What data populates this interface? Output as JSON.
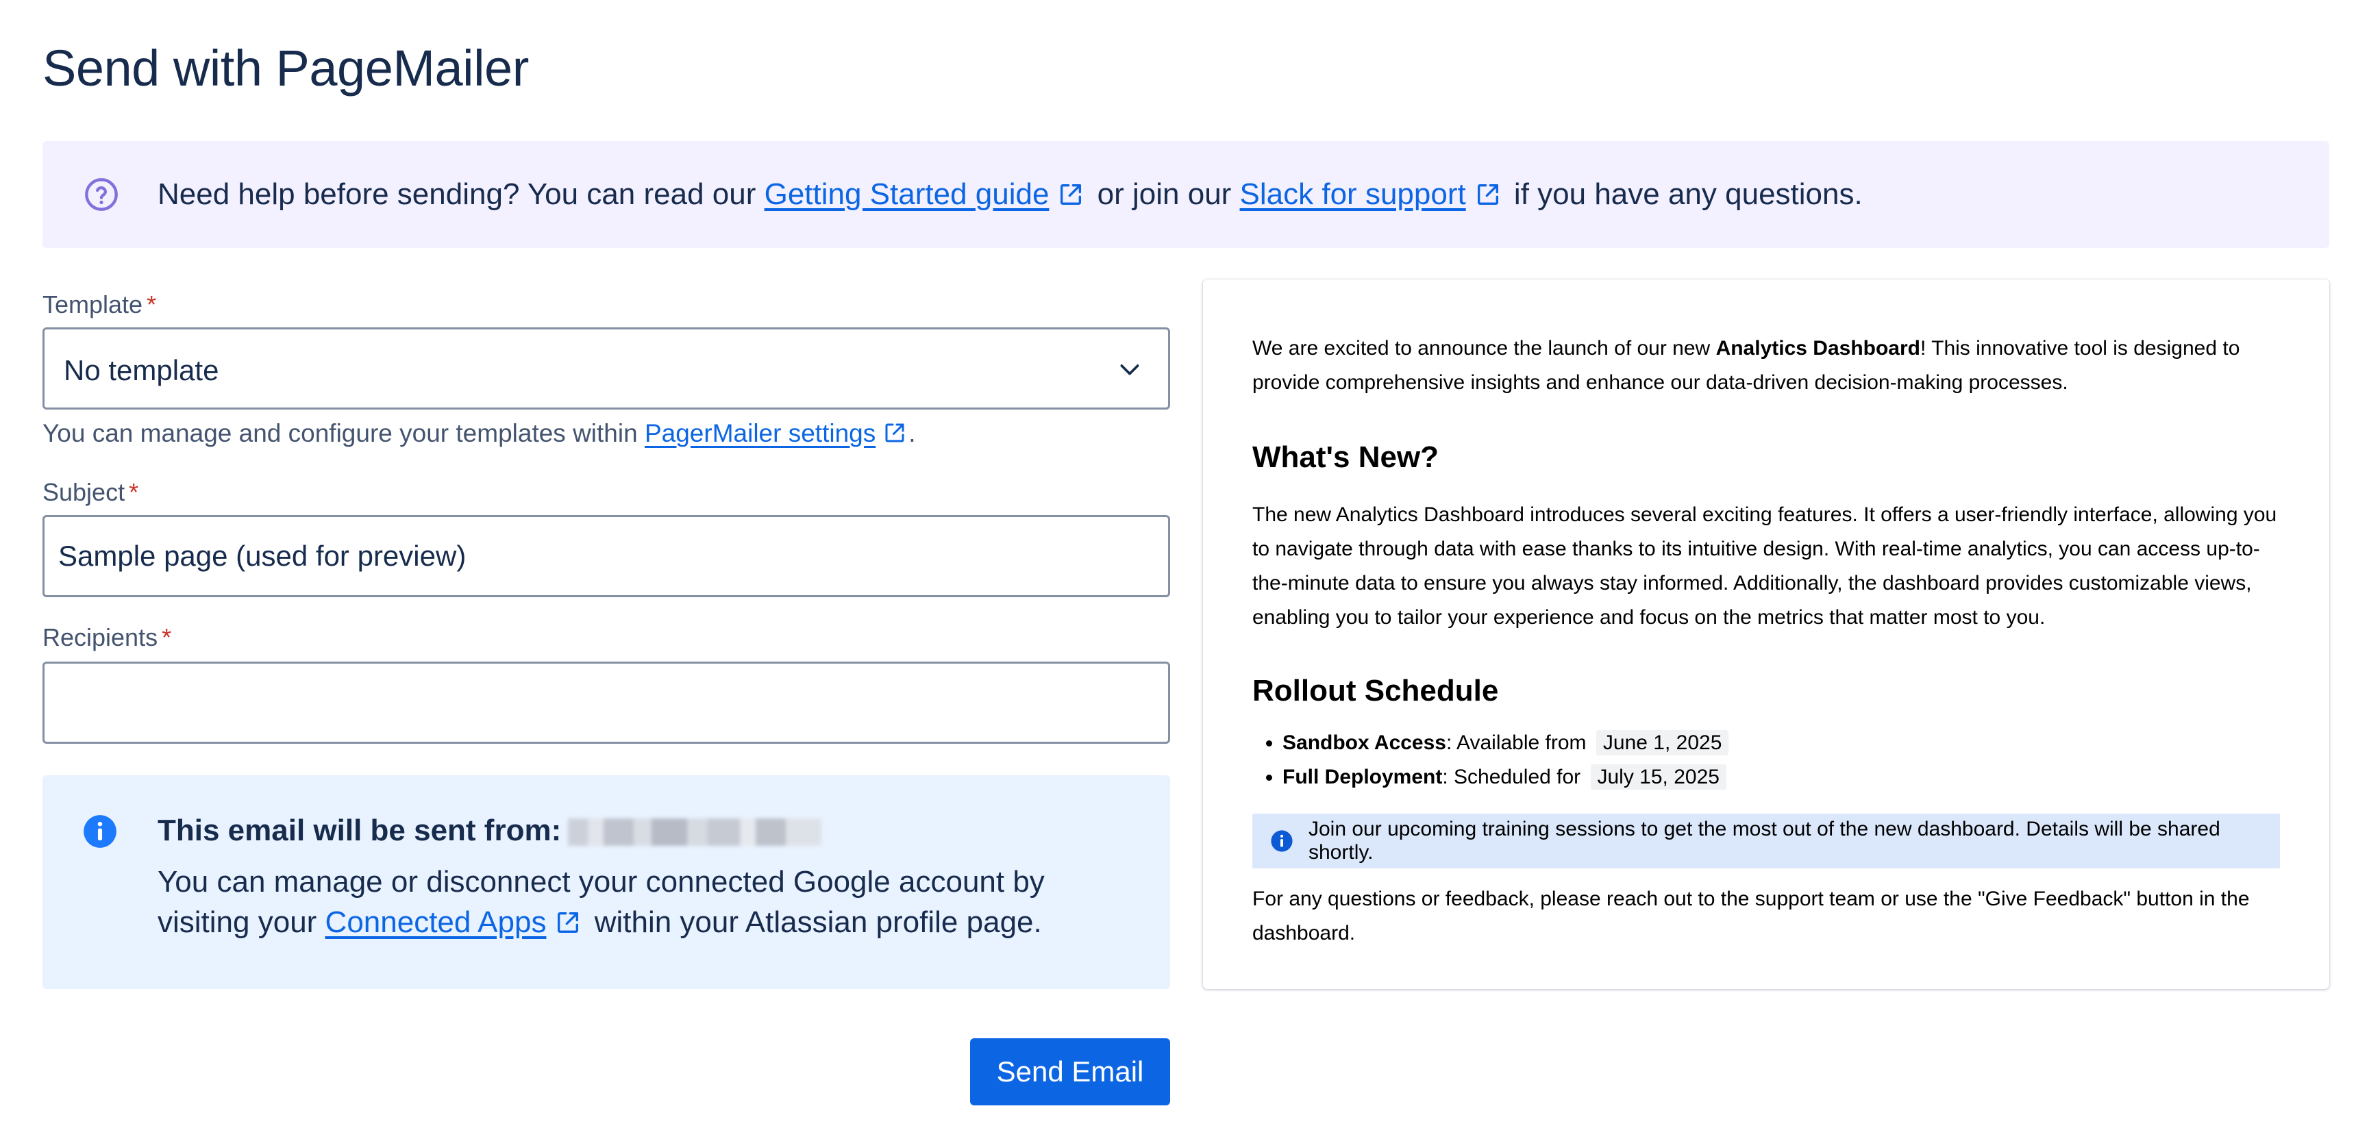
{
  "page": {
    "title": "Send with PageMailer"
  },
  "help_banner": {
    "text_before": "Need help before sending? You can read our ",
    "link1_label": "Getting Started guide",
    "text_middle": " or join our ",
    "link2_label": "Slack for support",
    "text_after": " if you have any questions.",
    "icon": "question-circle-icon"
  },
  "form": {
    "template": {
      "label": "Template",
      "required_mark": "*",
      "value": "No template",
      "helper_before": "You can manage and configure your templates within ",
      "helper_link": "PagerMailer settings",
      "helper_after": "."
    },
    "subject": {
      "label": "Subject",
      "required_mark": "*",
      "value": "Sample page (used for preview)"
    },
    "recipients": {
      "label": "Recipients",
      "required_mark": "*",
      "value": ""
    },
    "send_label": "Send Email"
  },
  "sender_info": {
    "title": "This email will be sent from:",
    "body_before": "You can manage or disconnect your connected Google account by visiting your ",
    "link_label": "Connected Apps",
    "body_after": " within your Atlassian profile page.",
    "icon": "info-circle-icon"
  },
  "preview": {
    "intro_before": "We are excited to announce the launch of our new ",
    "intro_bold": "Analytics Dashboard",
    "intro_after": "! This innovative tool is designed to provide comprehensive insights and enhance our data-driven decision-making processes.",
    "heading1": "What's New?",
    "paragraph1": "The new Analytics Dashboard introduces several exciting features. It offers a user-friendly interface, allowing you to navigate through data with ease thanks to its intuitive design. With real-time analytics, you can access up-to-the-minute data to ensure you always stay informed. Additionally, the dashboard provides customizable views, enabling you to tailor your experience and focus on the metrics that matter most to you.",
    "heading2": "Rollout Schedule",
    "schedule": [
      {
        "label": "Sandbox Access",
        "text": ": Available from ",
        "date": "June 1, 2025"
      },
      {
        "label": "Full Deployment",
        "text": ": Scheduled for ",
        "date": "July 15, 2025"
      }
    ],
    "info_note": "Join our upcoming training sessions to get the most out of the new dashboard. Details will be shared shortly.",
    "closing": "For any questions or feedback, please reach out to the support team or use the \"Give Feedback\" button in the dashboard."
  },
  "colors": {
    "brand_blue": "#0c66e4",
    "help_bg": "#f3f0ff",
    "info_bg": "#e9f2ff",
    "help_icon": "#8270db",
    "required": "#c9372c"
  }
}
